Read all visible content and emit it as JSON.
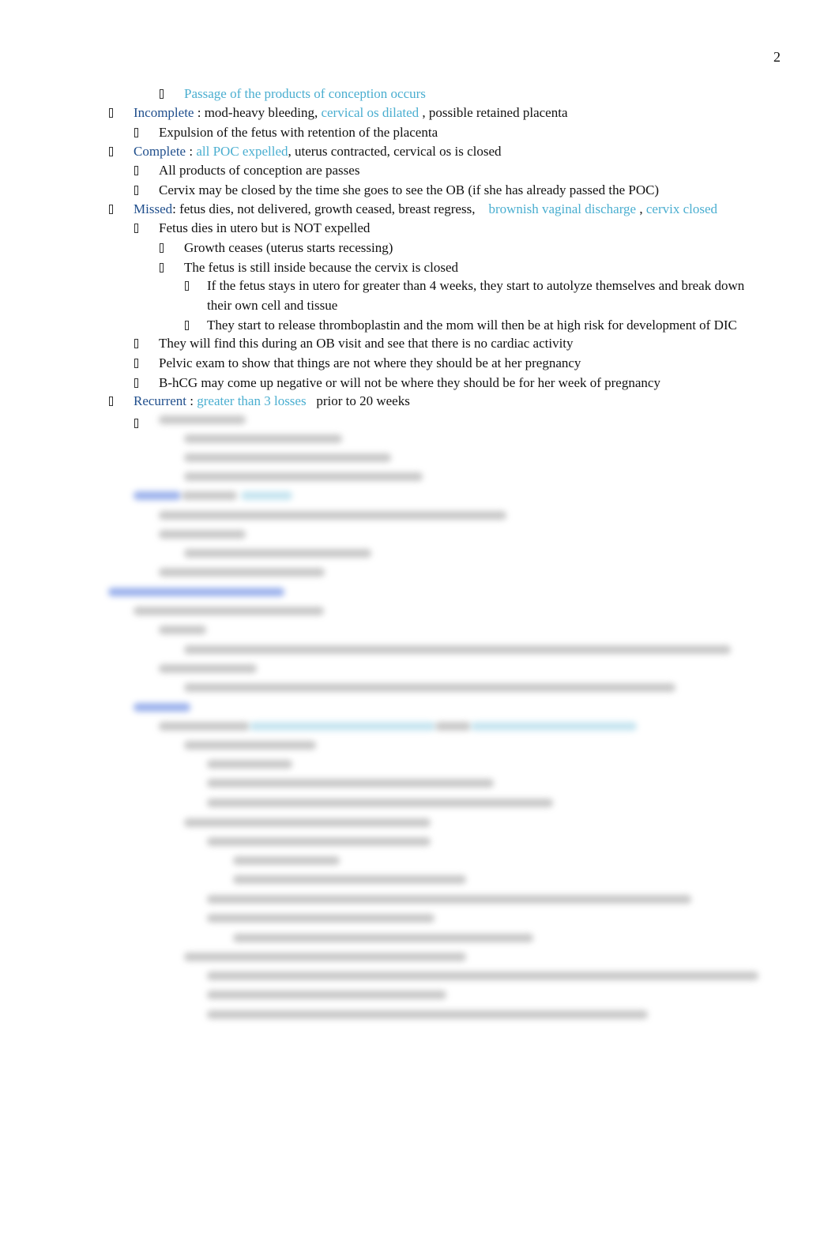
{
  "page_number": "2",
  "bullet_icon": "missing-glyph-box-icon",
  "colors": {
    "heading": "#1f4e8c",
    "highlight": "#4aaed0",
    "text": "#111111"
  },
  "lines": [
    {
      "level": 3,
      "parts": [
        {
          "t": "Passage of the products of conception occurs",
          "s": "hl"
        }
      ]
    },
    {
      "level": 1,
      "parts": [
        {
          "t": "Incomplete",
          "s": "hd"
        },
        {
          "t": " : mod-heavy bleeding, "
        },
        {
          "t": "cervical os dilated",
          "s": "hl"
        },
        {
          "t": " , possible retained placenta"
        }
      ]
    },
    {
      "level": 2,
      "parts": [
        {
          "t": "Expulsion of the fetus with retention of the placenta"
        }
      ]
    },
    {
      "level": 1,
      "parts": [
        {
          "t": "Complete",
          "s": "hd"
        },
        {
          "t": " : "
        },
        {
          "t": "all POC expelled",
          "s": "hl"
        },
        {
          "t": ", uterus contracted, cervical os is closed"
        }
      ]
    },
    {
      "level": 2,
      "parts": [
        {
          "t": "All products of conception are passes"
        }
      ]
    },
    {
      "level": 2,
      "parts": [
        {
          "t": "Cervix may be closed by the time she goes to see the OB (if she has already passed the POC)"
        }
      ]
    },
    {
      "level": 1,
      "parts": [
        {
          "t": "Missed",
          "s": "hd"
        },
        {
          "t": ": fetus dies, not delivered, growth ceased, breast regress,    "
        },
        {
          "t": "brownish vaginal discharge",
          "s": "hl"
        },
        {
          "t": " , "
        },
        {
          "t": "cervix closed",
          "s": "hl"
        }
      ]
    },
    {
      "level": 2,
      "parts": [
        {
          "t": "Fetus dies in utero but is NOT expelled"
        }
      ]
    },
    {
      "level": 3,
      "parts": [
        {
          "t": "Growth ceases (uterus starts recessing)"
        }
      ]
    },
    {
      "level": 3,
      "parts": [
        {
          "t": "The fetus is still inside because the cervix is closed"
        }
      ]
    },
    {
      "level": 4,
      "parts": [
        {
          "t": "If the fetus stays in utero for greater than 4 weeks, they start to autolyze themselves and break down"
        }
      ]
    },
    {
      "level": 4,
      "cont": true,
      "parts": [
        {
          "t": "their own cell and tissue"
        }
      ]
    },
    {
      "level": 4,
      "parts": [
        {
          "t": "They start to release thromboplastin and the mom will then be at high risk for development of DIC"
        }
      ]
    },
    {
      "level": 2,
      "parts": [
        {
          "t": "They will find this during an OB visit and see that there is no cardiac activity"
        }
      ]
    },
    {
      "level": 2,
      "parts": [
        {
          "t": "Pelvic exam to show that things are not where they should be at her pregnancy"
        }
      ]
    },
    {
      "level": 2,
      "parts": [
        {
          "t": "B-hCG may come up negative or will not be where they should be for her week of pregnancy"
        }
      ]
    },
    {
      "level": 1,
      "parts": [
        {
          "t": "Recurrent",
          "s": "hd"
        },
        {
          "t": " : "
        },
        {
          "t": "greater than 3 losses",
          "s": "hl"
        },
        {
          "t": "   prior to 20 weeks"
        }
      ]
    }
  ]
}
